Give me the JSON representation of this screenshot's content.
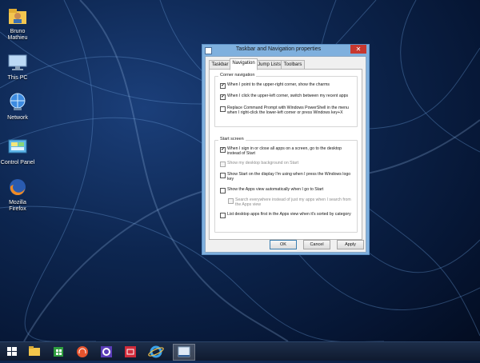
{
  "desktop": {
    "icons": [
      {
        "label": "Bruno Mathieu",
        "icon": "user-folder-icon"
      },
      {
        "label": "This PC",
        "icon": "computer-icon"
      },
      {
        "label": "Network",
        "icon": "network-globe-icon"
      },
      {
        "label": "Control Panel",
        "icon": "control-panel-icon"
      },
      {
        "label": "Mozilla Firefox",
        "icon": "firefox-icon"
      }
    ]
  },
  "dialog": {
    "title": "Taskbar and Navigation properties",
    "close_symbol": "✕",
    "tabs": [
      {
        "label": "Taskbar",
        "active": false
      },
      {
        "label": "Navigation",
        "active": true
      },
      {
        "label": "Jump Lists",
        "active": false
      },
      {
        "label": "Toolbars",
        "active": false
      }
    ],
    "corner_navigation": {
      "title": "Corner navigation",
      "options": [
        {
          "label": "When I point to the upper-right corner, show the charms",
          "checked": true,
          "enabled": true
        },
        {
          "label": "When I click the upper-left corner, switch between my recent apps",
          "checked": true,
          "enabled": true
        },
        {
          "label": "Replace Command Prompt with Windows PowerShell in the menu when I right-click the lower-left corner or press Windows key+X",
          "checked": false,
          "enabled": true
        }
      ]
    },
    "start_screen": {
      "title": "Start screen",
      "options": [
        {
          "label": "When I sign in or close all apps on a screen, go to the desktop instead of Start",
          "checked": true,
          "enabled": true
        },
        {
          "label": "Show my desktop background on Start",
          "checked": false,
          "enabled": false
        },
        {
          "label": "Show Start on the display I'm using when I press the Windows logo key",
          "checked": false,
          "enabled": true
        },
        {
          "label": "Show the Apps view automatically when I go to Start",
          "checked": false,
          "enabled": true
        },
        {
          "label": "Search everywhere instead of just my apps when I search from the Apps view",
          "checked": false,
          "enabled": false
        },
        {
          "label": "List desktop apps first in the Apps view when it's sorted by category",
          "checked": false,
          "enabled": true
        }
      ]
    },
    "buttons": {
      "ok": "OK",
      "cancel": "Cancel",
      "apply": "Apply"
    },
    "check_mark": "✔"
  },
  "taskbar": {
    "items": [
      {
        "icon": "windows-start-icon",
        "active": false
      },
      {
        "icon": "file-explorer-icon",
        "active": false
      },
      {
        "icon": "store-icon",
        "active": false
      },
      {
        "icon": "music-headphones-icon",
        "active": false
      },
      {
        "icon": "settings-gear-icon",
        "active": false
      },
      {
        "icon": "video-icon",
        "active": false
      },
      {
        "icon": "internet-explorer-icon",
        "active": false
      },
      {
        "icon": "taskbar-properties-icon",
        "active": true
      }
    ]
  }
}
